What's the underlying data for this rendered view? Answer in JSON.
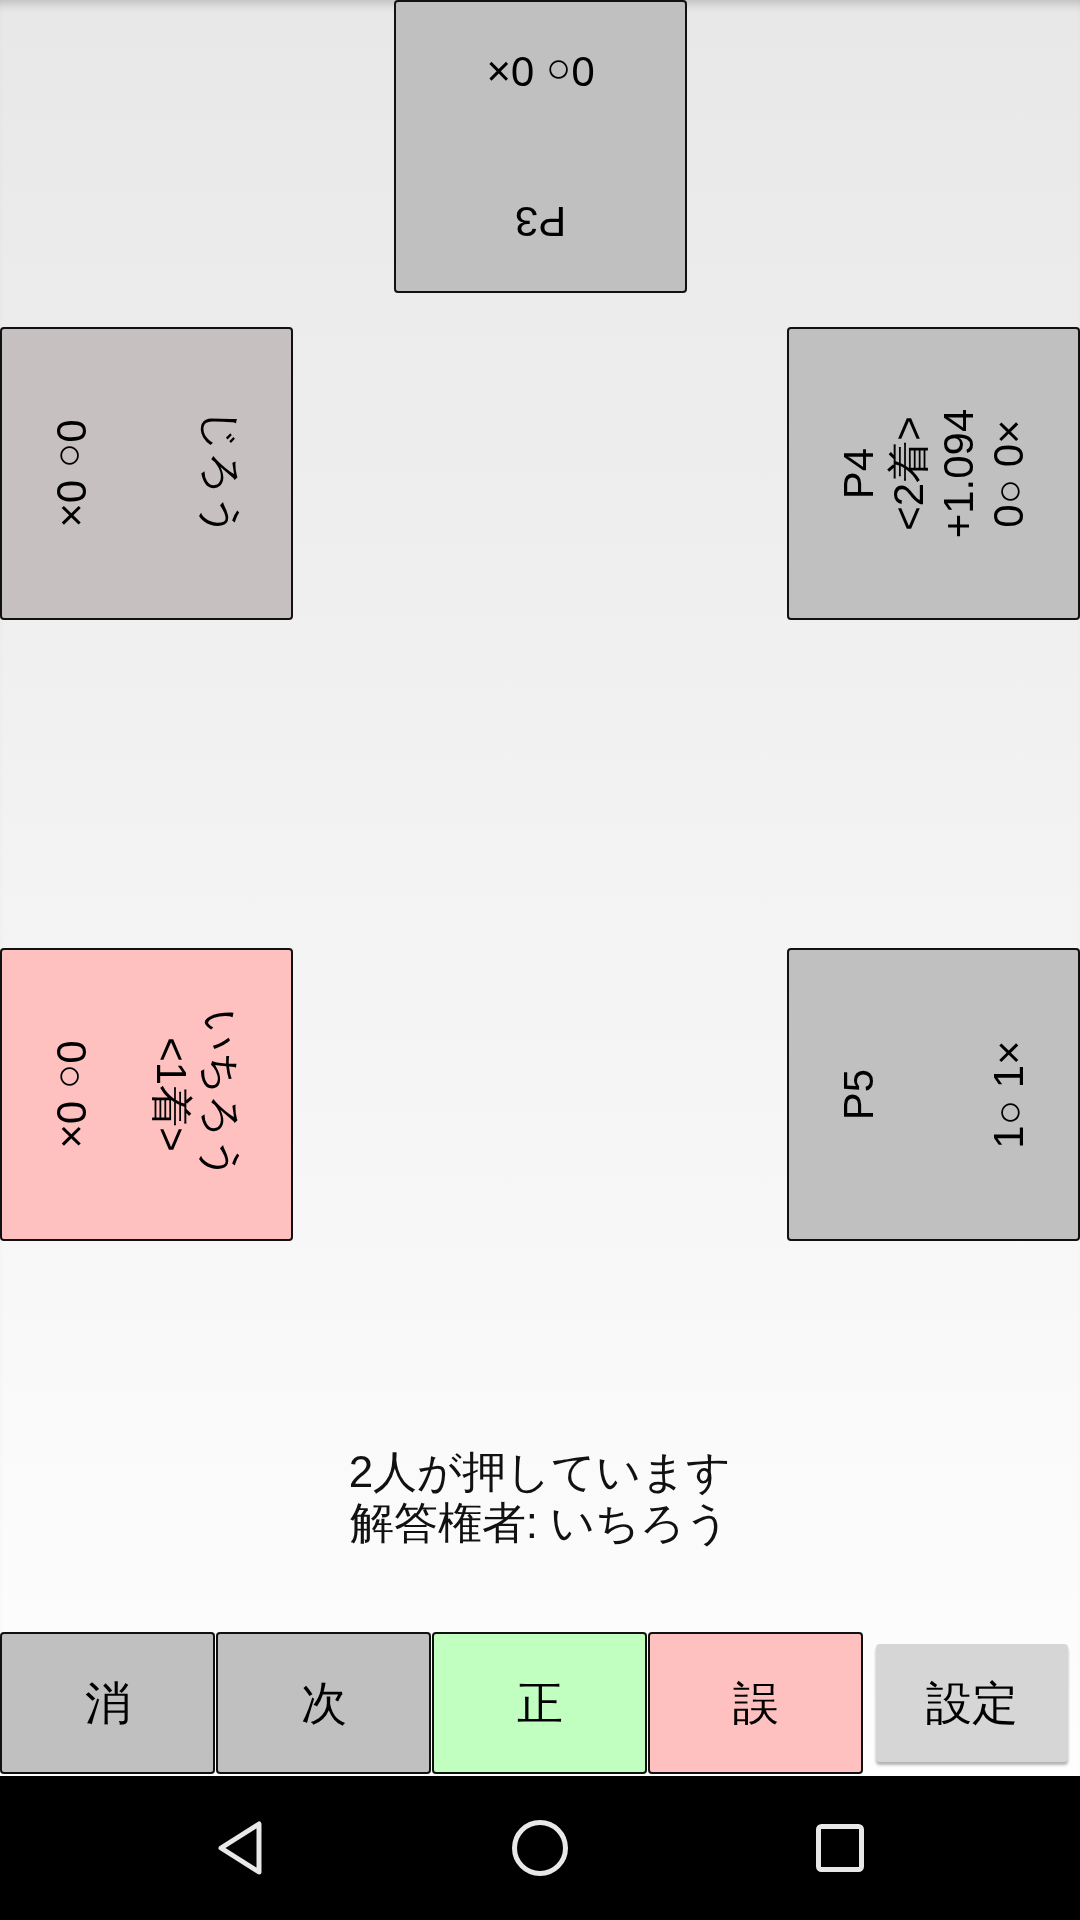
{
  "player_rows": [
    {
      "players": [
        {
          "kind": "inverted",
          "name": "P3",
          "score": "0○ 0×",
          "color": "#c0c0c0"
        }
      ]
    },
    {
      "players": [
        {
          "kind": "clockwise",
          "name": "じろう",
          "score": "0○ 0×",
          "color": "#c6c0c0"
        },
        {
          "kind": "counterclockwise",
          "name": "P4",
          "rank": "<2着>",
          "time": "+1.094",
          "score": "0○ 0×",
          "color": "#c0c0c0"
        }
      ]
    },
    {
      "players": [
        {
          "kind": "clockwise",
          "name": "いちろう",
          "rank": "<1着>",
          "score": "0○ 0×",
          "color": "#ffc0c0"
        },
        {
          "kind": "counterclockwise",
          "name": "P5",
          "score": "1○ 1×",
          "color": "#c0c0c0"
        }
      ]
    }
  ],
  "status": {
    "buzzers": "2人が押しています",
    "answerer": "解答権者: いちろう"
  },
  "buttons": [
    {
      "label": "消",
      "kind": "flat",
      "color": "#c0c0c0"
    },
    {
      "label": "次",
      "kind": "flat",
      "color": "#c0c0c0"
    },
    {
      "label": "正",
      "kind": "flat",
      "color": "#c0ffc0"
    },
    {
      "label": "誤",
      "kind": "flat",
      "color": "#ffc0c0"
    },
    {
      "label": "設定",
      "kind": "raised"
    }
  ]
}
